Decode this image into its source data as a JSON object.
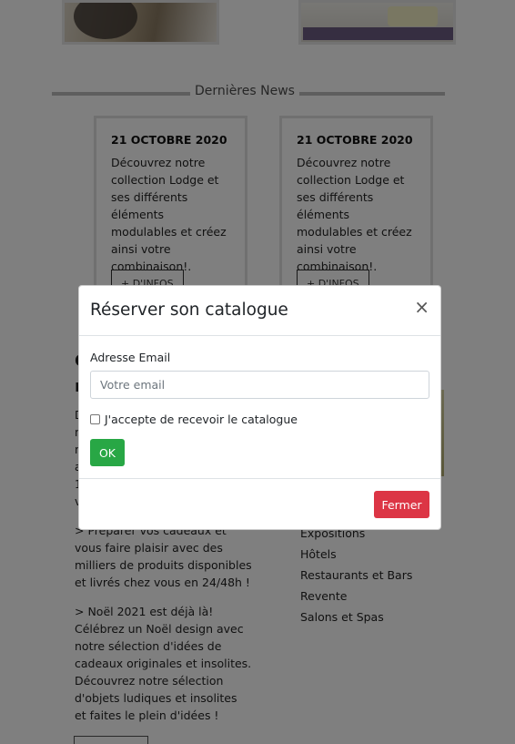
{
  "news": {
    "title": "Dernières News",
    "cards": [
      {
        "date": "21 OCTOBRE 2020",
        "text": "Découvrez notre collection Lodge et ses différents éléments modulables et créez ainsi votre combinaison!.",
        "button": "+ D'INFOS"
      },
      {
        "date": "21 OCTOBRE 2020",
        "text": "Découvrez notre collection Lodge et ses différents éléments modulables et créez ainsi votre combinaison!.",
        "button": "+ D'INFOS"
      }
    ]
  },
  "content": {
    "heading_partial_1": "C",
    "heading_partial_2": "n",
    "partial_lines": [
      "D",
      "n",
      "n",
      "a",
      "1",
      "v"
    ],
    "paragraph_1": "> Préparer vos cadeaux et vous faire plaisir avec des milliers de produits disponibles et livrés chez vous en 24/48h !",
    "paragraph_2": "> Noël 2021 est déjà là! Célébrez un Noël design avec notre sélection d'idées de cadeaux originales et insolites. Découvrez notre sélection d'objets ludiques et insolites et faites le plein d'idées !"
  },
  "sidebar_list": [
    "Expositions",
    "Hôtels",
    "Restaurants et Bars",
    "Revente",
    "Salons et Spas"
  ],
  "modal": {
    "title": "Réserver son catalogue",
    "close_symbol": "×",
    "email_label": "Adresse Email",
    "email_placeholder": "Votre email",
    "email_value": "",
    "checkbox_label": "J'accepte de recevoir le catalogue",
    "checkbox_checked": false,
    "ok_label": "OK",
    "dismiss_label": "Fermer"
  },
  "colors": {
    "ok": "#28a745",
    "dismiss": "#dc3545"
  }
}
